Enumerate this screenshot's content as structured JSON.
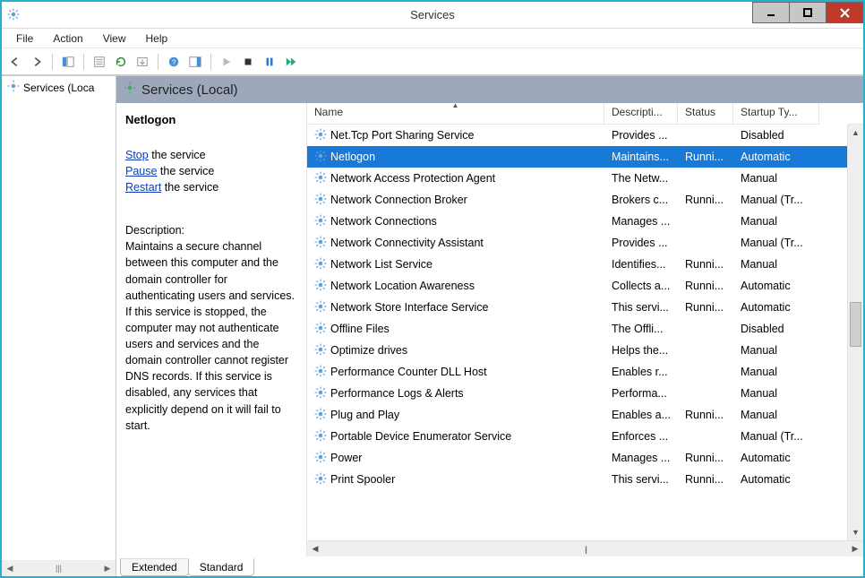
{
  "window": {
    "title": "Services"
  },
  "menubar": [
    "File",
    "Action",
    "View",
    "Help"
  ],
  "toolbar_icons": [
    "back-arrow-icon",
    "forward-arrow-icon",
    "up-icon",
    "properties-icon",
    "refresh-icon",
    "export-icon",
    "help-icon",
    "show-hide-icon",
    "play-icon",
    "stop-icon",
    "pause-icon",
    "restart-icon"
  ],
  "tree": {
    "root": "Services (Loca"
  },
  "header": "Services (Local)",
  "detail": {
    "name": "Netlogon",
    "actions": {
      "stop_link": "Stop",
      "stop_suffix": " the service",
      "pause_link": "Pause",
      "pause_suffix": " the service",
      "restart_link": "Restart",
      "restart_suffix": " the service"
    },
    "desc_label": "Description:",
    "description": "Maintains a secure channel between this computer and the domain controller for authenticating users and services. If this service is stopped, the computer may not authenticate users and services and the domain controller cannot register DNS records. If this service is disabled, any services that explicitly depend on it will fail to start."
  },
  "columns": [
    "Name",
    "Descripti...",
    "Status",
    "Startup Ty..."
  ],
  "services": [
    {
      "name": "Net.Tcp Port Sharing Service",
      "desc": "Provides ...",
      "status": "",
      "startup": "Disabled",
      "selected": false
    },
    {
      "name": "Netlogon",
      "desc": "Maintains...",
      "status": "Runni...",
      "startup": "Automatic",
      "selected": true
    },
    {
      "name": "Network Access Protection Agent",
      "desc": "The Netw...",
      "status": "",
      "startup": "Manual",
      "selected": false
    },
    {
      "name": "Network Connection Broker",
      "desc": "Brokers c...",
      "status": "Runni...",
      "startup": "Manual (Tr...",
      "selected": false
    },
    {
      "name": "Network Connections",
      "desc": "Manages ...",
      "status": "",
      "startup": "Manual",
      "selected": false
    },
    {
      "name": "Network Connectivity Assistant",
      "desc": "Provides ...",
      "status": "",
      "startup": "Manual (Tr...",
      "selected": false
    },
    {
      "name": "Network List Service",
      "desc": "Identifies...",
      "status": "Runni...",
      "startup": "Manual",
      "selected": false
    },
    {
      "name": "Network Location Awareness",
      "desc": "Collects a...",
      "status": "Runni...",
      "startup": "Automatic",
      "selected": false
    },
    {
      "name": "Network Store Interface Service",
      "desc": "This servi...",
      "status": "Runni...",
      "startup": "Automatic",
      "selected": false
    },
    {
      "name": "Offline Files",
      "desc": "The Offli...",
      "status": "",
      "startup": "Disabled",
      "selected": false
    },
    {
      "name": "Optimize drives",
      "desc": "Helps the...",
      "status": "",
      "startup": "Manual",
      "selected": false
    },
    {
      "name": "Performance Counter DLL Host",
      "desc": "Enables r...",
      "status": "",
      "startup": "Manual",
      "selected": false
    },
    {
      "name": "Performance Logs & Alerts",
      "desc": "Performa...",
      "status": "",
      "startup": "Manual",
      "selected": false
    },
    {
      "name": "Plug and Play",
      "desc": "Enables a...",
      "status": "Runni...",
      "startup": "Manual",
      "selected": false
    },
    {
      "name": "Portable Device Enumerator Service",
      "desc": "Enforces ...",
      "status": "",
      "startup": "Manual (Tr...",
      "selected": false
    },
    {
      "name": "Power",
      "desc": "Manages ...",
      "status": "Runni...",
      "startup": "Automatic",
      "selected": false
    },
    {
      "name": "Print Spooler",
      "desc": "This servi...",
      "status": "Runni...",
      "startup": "Automatic",
      "selected": false
    }
  ],
  "tabs": {
    "extended": "Extended",
    "standard": "Standard",
    "active": "standard"
  }
}
